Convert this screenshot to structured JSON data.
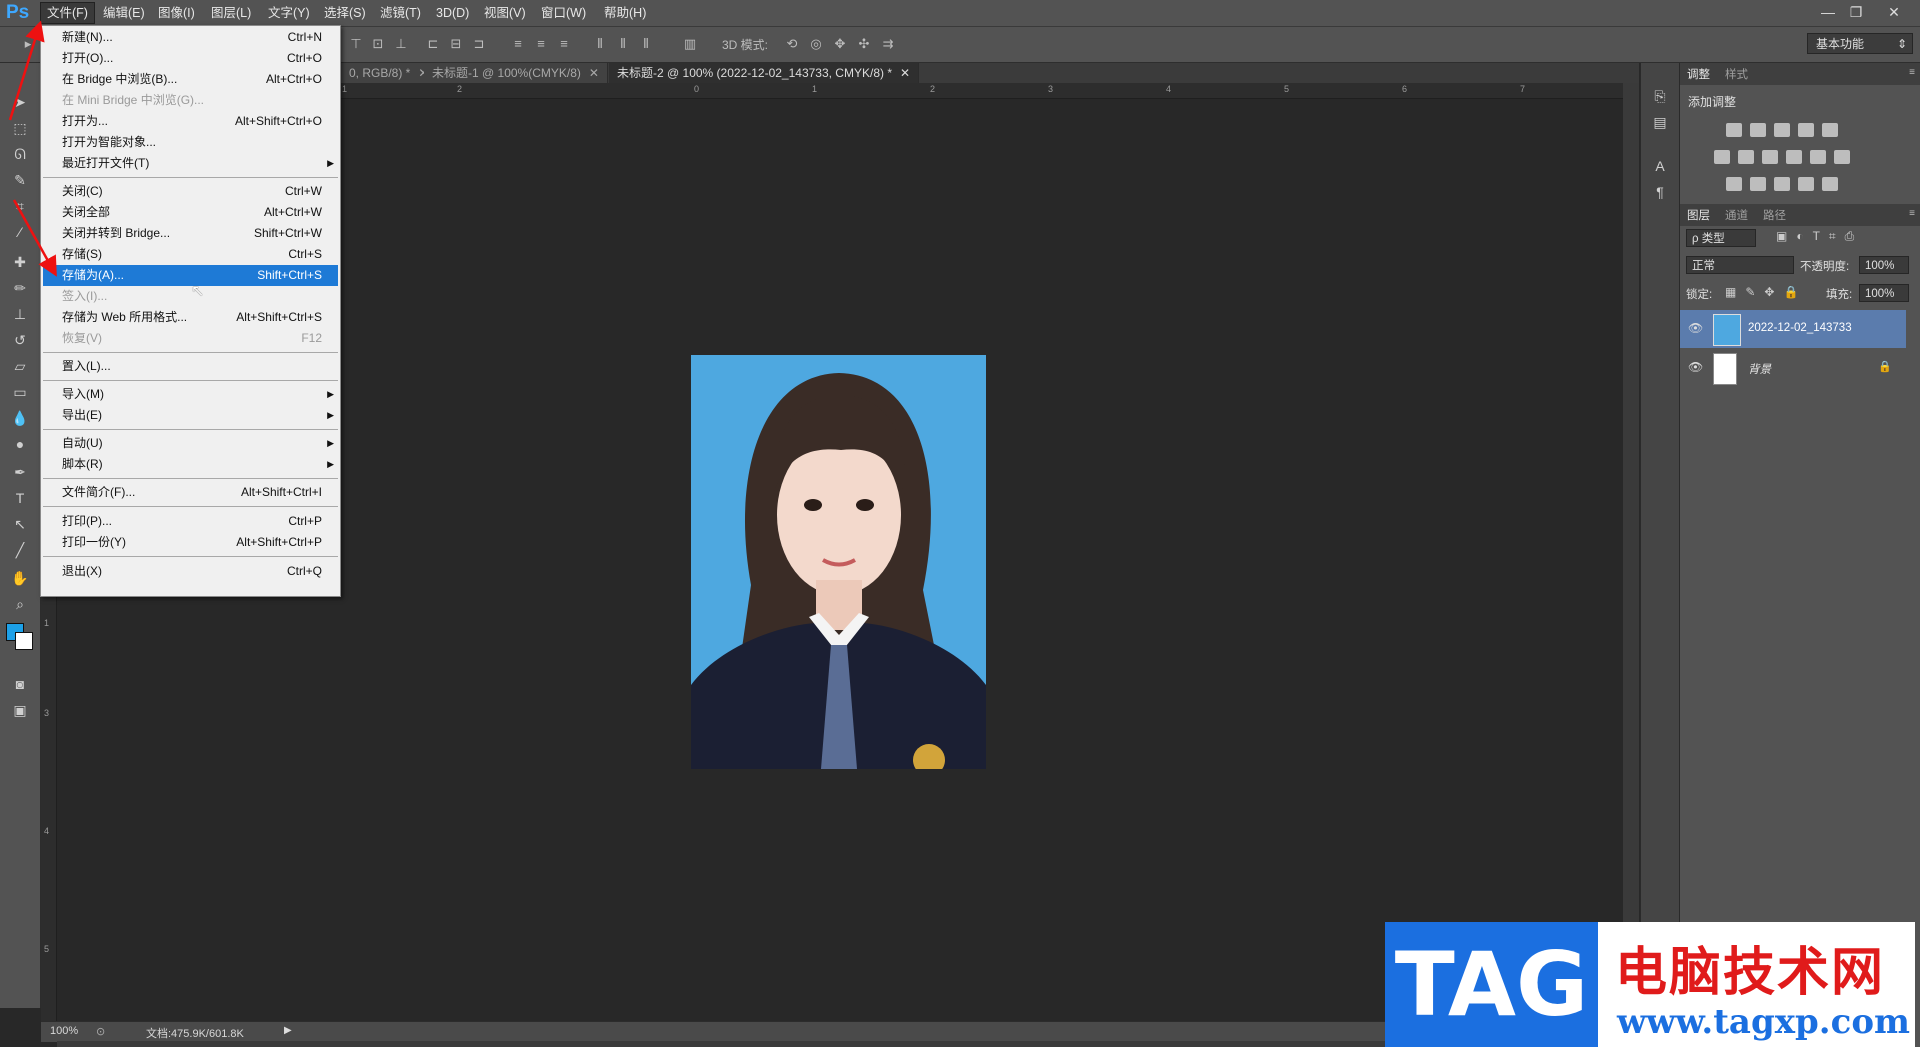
{
  "app": {
    "logo": "Ps"
  },
  "menubar": {
    "items": [
      "文件(F)",
      "编辑(E)",
      "图像(I)",
      "图层(L)",
      "文字(Y)",
      "选择(S)",
      "滤镜(T)",
      "3D(D)",
      "视图(V)",
      "窗口(W)",
      "帮助(H)"
    ],
    "window_buttons": [
      "—",
      "❐",
      "✕"
    ]
  },
  "options": {
    "mode3d": "3D 模式:",
    "workspace": "基本功能"
  },
  "tabs": [
    {
      "label": "0, RGB/8) *"
    },
    {
      "label": "未标题-1 @ 100%(CMYK/8)"
    },
    {
      "label": "未标题-2 @ 100% (2022-12-02_143733, CMYK/8) *"
    }
  ],
  "ruler": {
    "h_labels": [
      "1",
      "2",
      "0",
      "1",
      "2",
      "3",
      "4",
      "5",
      "6",
      "7"
    ],
    "v_labels": [
      "1",
      "3",
      "4",
      "5"
    ]
  },
  "file_menu": {
    "items": [
      {
        "label": "新建(N)...",
        "shortcut": "Ctrl+N"
      },
      {
        "label": "打开(O)...",
        "shortcut": "Ctrl+O"
      },
      {
        "label": "在 Bridge 中浏览(B)...",
        "shortcut": "Alt+Ctrl+O"
      },
      {
        "label": "在 Mini Bridge 中浏览(G)...",
        "shortcut": ""
      },
      {
        "label": "打开为...",
        "shortcut": "Alt+Shift+Ctrl+O"
      },
      {
        "label": "打开为智能对象...",
        "shortcut": ""
      },
      {
        "label": "最近打开文件(T)",
        "shortcut": ""
      },
      {
        "label": "关闭(C)",
        "shortcut": "Ctrl+W"
      },
      {
        "label": "关闭全部",
        "shortcut": "Alt+Ctrl+W"
      },
      {
        "label": "关闭并转到 Bridge...",
        "shortcut": "Shift+Ctrl+W"
      },
      {
        "label": "存储(S)",
        "shortcut": "Ctrl+S"
      },
      {
        "label": "存储为(A)...",
        "shortcut": "Shift+Ctrl+S"
      },
      {
        "label": "签入(I)...",
        "shortcut": ""
      },
      {
        "label": "存储为 Web 所用格式...",
        "shortcut": "Alt+Shift+Ctrl+S"
      },
      {
        "label": "恢复(V)",
        "shortcut": "F12"
      },
      {
        "label": "置入(L)...",
        "shortcut": ""
      },
      {
        "label": "导入(M)",
        "shortcut": ""
      },
      {
        "label": "导出(E)",
        "shortcut": ""
      },
      {
        "label": "自动(U)",
        "shortcut": ""
      },
      {
        "label": "脚本(R)",
        "shortcut": ""
      },
      {
        "label": "文件简介(F)...",
        "shortcut": "Alt+Shift+Ctrl+I"
      },
      {
        "label": "打印(P)...",
        "shortcut": "Ctrl+P"
      },
      {
        "label": "打印一份(Y)",
        "shortcut": "Alt+Shift+Ctrl+P"
      },
      {
        "label": "退出(X)",
        "shortcut": "Ctrl+Q"
      }
    ]
  },
  "status": {
    "zoom": "100%",
    "doc": "文档:475.9K/601.8K"
  },
  "adjust_panel": {
    "tabs": [
      "调整",
      "样式"
    ],
    "title": "添加调整"
  },
  "layers_panel": {
    "tabs": [
      "图层",
      "通道",
      "路径"
    ],
    "filter": "ρ 类型",
    "blend": "正常",
    "opacity_label": "不透明度:",
    "opacity": "100%",
    "lock_label": "锁定:",
    "fill_label": "填充:",
    "fill": "100%",
    "layers": [
      {
        "name": "2022-12-02_143733"
      },
      {
        "name": "背景"
      }
    ]
  },
  "watermark": {
    "tag": "TAG",
    "cn": "电脑技术网",
    "url": "www.tagxp.com"
  },
  "colors": {
    "accent": "#1e7ad6",
    "photo_bg": "#4ea8e0",
    "ps_blue": "#3ea8ff"
  }
}
